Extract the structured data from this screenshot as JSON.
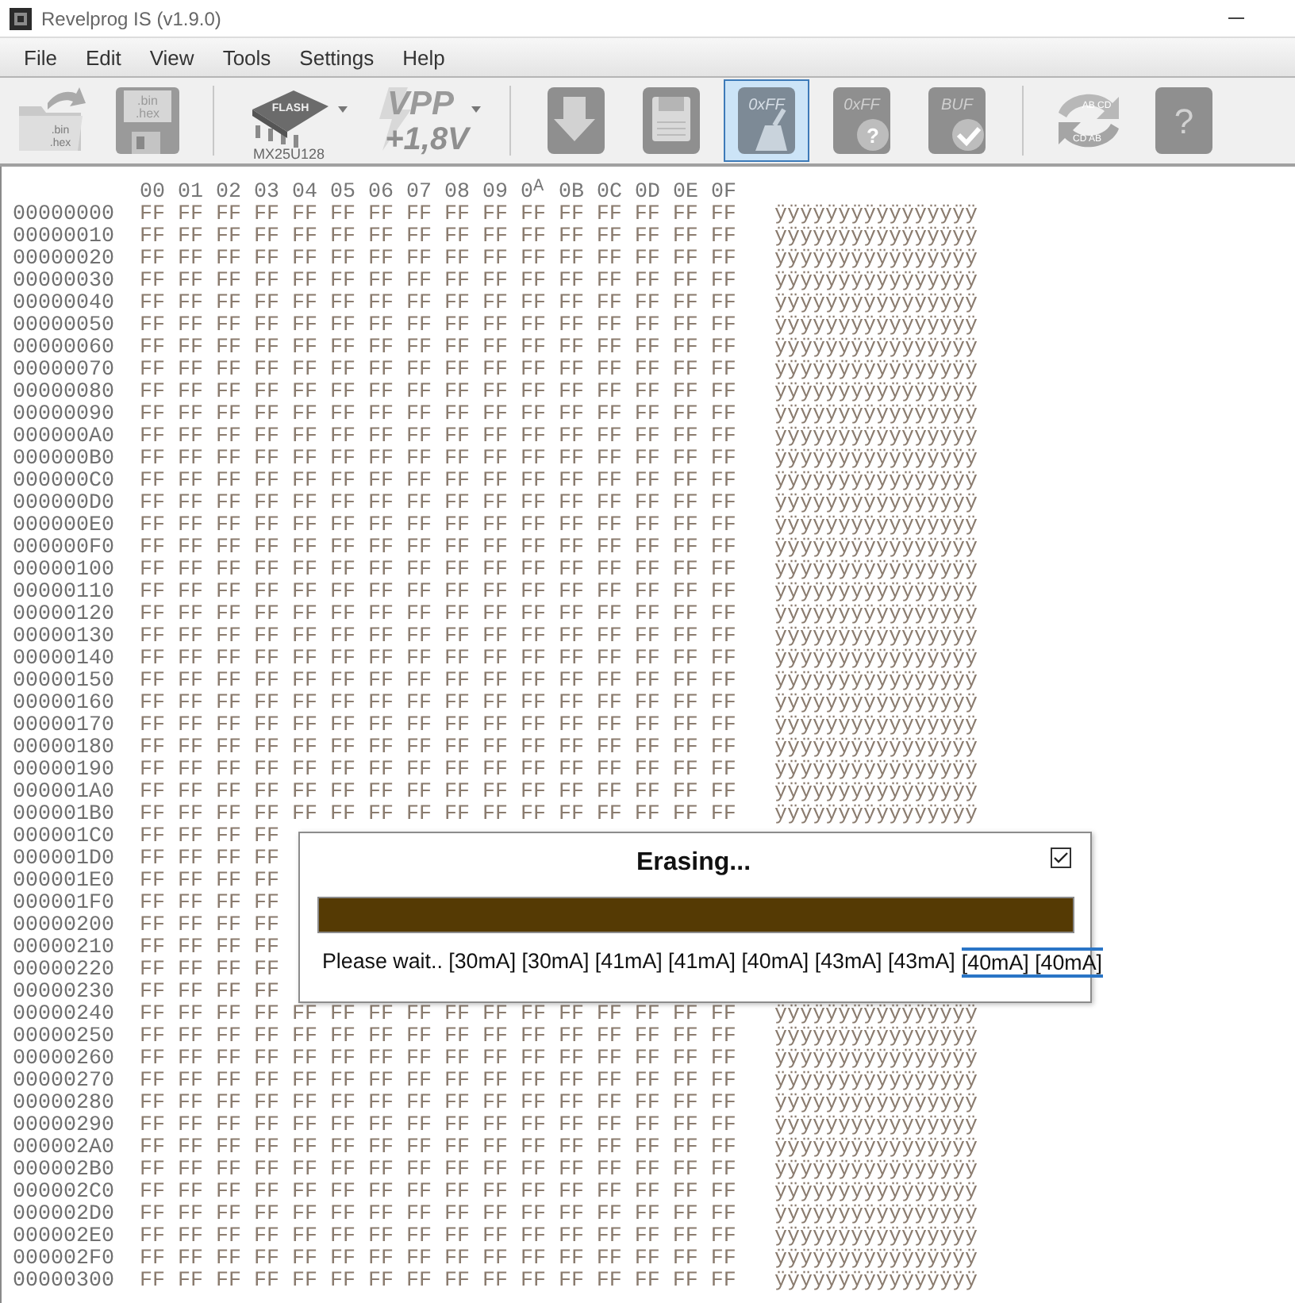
{
  "window": {
    "title": "Revelprog IS (v1.9.0)"
  },
  "menu": [
    "File",
    "Edit",
    "View",
    "Tools",
    "Settings",
    "Help"
  ],
  "toolbar": [
    {
      "kind": "open",
      "texts": [
        ".bin",
        ".hex"
      ],
      "selected": false
    },
    {
      "kind": "save-file",
      "texts": [
        ".bin",
        ".hex"
      ],
      "selected": false
    },
    {
      "kind": "separator"
    },
    {
      "kind": "chip",
      "texts": [
        "FLASH",
        "MX25U128"
      ],
      "dropdown": true,
      "selected": false
    },
    {
      "kind": "vpp",
      "texts": [
        "VPP",
        "+1,8V"
      ],
      "dropdown": true,
      "selected": false
    },
    {
      "kind": "separator"
    },
    {
      "kind": "read",
      "selected": false
    },
    {
      "kind": "save",
      "selected": false
    },
    {
      "kind": "erase",
      "texts": [
        "0xFF"
      ],
      "selected": true
    },
    {
      "kind": "blank-check",
      "texts": [
        "0xFF",
        "?"
      ],
      "selected": false
    },
    {
      "kind": "verify",
      "texts": [
        "BUF"
      ],
      "selected": false
    },
    {
      "kind": "separator"
    },
    {
      "kind": "swap",
      "texts": [
        "AB CD",
        "CD AB"
      ],
      "selected": false
    },
    {
      "kind": "help",
      "texts": [
        "?"
      ],
      "selected": false
    }
  ],
  "hex_view": {
    "columns": [
      "00",
      "01",
      "02",
      "03",
      "04",
      "05",
      "06",
      "07",
      "08",
      "09",
      "0$^{A}$",
      "0B",
      "0C",
      "0D",
      "0E",
      "0F"
    ],
    "rows": [
      {
        "address": "00000000",
        "bytes": "FF FF FF FF FF FF FF FF FF FF FF FF FF FF FF FF",
        "ascii": "ÿÿÿÿÿÿÿÿÿÿÿÿÿÿÿÿ"
      },
      {
        "address": "00000010",
        "bytes": "FF FF FF FF FF FF FF FF FF FF FF FF FF FF FF FF",
        "ascii": "ÿÿÿÿÿÿÿÿÿÿÿÿÿÿÿÿ"
      },
      {
        "address": "00000020",
        "bytes": "FF FF FF FF FF FF FF FF FF FF FF FF FF FF FF FF",
        "ascii": "ÿÿÿÿÿÿÿÿÿÿÿÿÿÿÿÿ"
      },
      {
        "address": "00000030",
        "bytes": "FF FF FF FF FF FF FF FF FF FF FF FF FF FF FF FF",
        "ascii": "ÿÿÿÿÿÿÿÿÿÿÿÿÿÿÿÿ"
      },
      {
        "address": "00000040",
        "bytes": "FF FF FF FF FF FF FF FF FF FF FF FF FF FF FF FF",
        "ascii": "ÿÿÿÿÿÿÿÿÿÿÿÿÿÿÿÿ"
      },
      {
        "address": "00000050",
        "bytes": "FF FF FF FF FF FF FF FF FF FF FF FF FF FF FF FF",
        "ascii": "ÿÿÿÿÿÿÿÿÿÿÿÿÿÿÿÿ"
      },
      {
        "address": "00000060",
        "bytes": "FF FF FF FF FF FF FF FF FF FF FF FF FF FF FF FF",
        "ascii": "ÿÿÿÿÿÿÿÿÿÿÿÿÿÿÿÿ"
      },
      {
        "address": "00000070",
        "bytes": "FF FF FF FF FF FF FF FF FF FF FF FF FF FF FF FF",
        "ascii": "ÿÿÿÿÿÿÿÿÿÿÿÿÿÿÿÿ"
      },
      {
        "address": "00000080",
        "bytes": "FF FF FF FF FF FF FF FF FF FF FF FF FF FF FF FF",
        "ascii": "ÿÿÿÿÿÿÿÿÿÿÿÿÿÿÿÿ"
      },
      {
        "address": "00000090",
        "bytes": "FF FF FF FF FF FF FF FF FF FF FF FF FF FF FF FF",
        "ascii": "ÿÿÿÿÿÿÿÿÿÿÿÿÿÿÿÿ"
      },
      {
        "address": "000000A0",
        "bytes": "FF FF FF FF FF FF FF FF FF FF FF FF FF FF FF FF",
        "ascii": "ÿÿÿÿÿÿÿÿÿÿÿÿÿÿÿÿ"
      },
      {
        "address": "000000B0",
        "bytes": "FF FF FF FF FF FF FF FF FF FF FF FF FF FF FF FF",
        "ascii": "ÿÿÿÿÿÿÿÿÿÿÿÿÿÿÿÿ"
      },
      {
        "address": "000000C0",
        "bytes": "FF FF FF FF FF FF FF FF FF FF FF FF FF FF FF FF",
        "ascii": "ÿÿÿÿÿÿÿÿÿÿÿÿÿÿÿÿ"
      },
      {
        "address": "000000D0",
        "bytes": "FF FF FF FF FF FF FF FF FF FF FF FF FF FF FF FF",
        "ascii": "ÿÿÿÿÿÿÿÿÿÿÿÿÿÿÿÿ"
      },
      {
        "address": "000000E0",
        "bytes": "FF FF FF FF FF FF FF FF FF FF FF FF FF FF FF FF",
        "ascii": "ÿÿÿÿÿÿÿÿÿÿÿÿÿÿÿÿ"
      },
      {
        "address": "000000F0",
        "bytes": "FF FF FF FF FF FF FF FF FF FF FF FF FF FF FF FF",
        "ascii": "ÿÿÿÿÿÿÿÿÿÿÿÿÿÿÿÿ"
      },
      {
        "address": "00000100",
        "bytes": "FF FF FF FF FF FF FF FF FF FF FF FF FF FF FF FF",
        "ascii": "ÿÿÿÿÿÿÿÿÿÿÿÿÿÿÿÿ"
      },
      {
        "address": "00000110",
        "bytes": "FF FF FF FF FF FF FF FF FF FF FF FF FF FF FF FF",
        "ascii": "ÿÿÿÿÿÿÿÿÿÿÿÿÿÿÿÿ"
      },
      {
        "address": "00000120",
        "bytes": "FF FF FF FF FF FF FF FF FF FF FF FF FF FF FF FF",
        "ascii": "ÿÿÿÿÿÿÿÿÿÿÿÿÿÿÿÿ"
      },
      {
        "address": "00000130",
        "bytes": "FF FF FF FF FF FF FF FF FF FF FF FF FF FF FF FF",
        "ascii": "ÿÿÿÿÿÿÿÿÿÿÿÿÿÿÿÿ"
      },
      {
        "address": "00000140",
        "bytes": "FF FF FF FF FF FF FF FF FF FF FF FF FF FF FF FF",
        "ascii": "ÿÿÿÿÿÿÿÿÿÿÿÿÿÿÿÿ"
      },
      {
        "address": "00000150",
        "bytes": "FF FF FF FF FF FF FF FF FF FF FF FF FF FF FF FF",
        "ascii": "ÿÿÿÿÿÿÿÿÿÿÿÿÿÿÿÿ"
      },
      {
        "address": "00000160",
        "bytes": "FF FF FF FF FF FF FF FF FF FF FF FF FF FF FF FF",
        "ascii": "ÿÿÿÿÿÿÿÿÿÿÿÿÿÿÿÿ"
      },
      {
        "address": "00000170",
        "bytes": "FF FF FF FF FF FF FF FF FF FF FF FF FF FF FF FF",
        "ascii": "ÿÿÿÿÿÿÿÿÿÿÿÿÿÿÿÿ"
      },
      {
        "address": "00000180",
        "bytes": "FF FF FF FF FF FF FF FF FF FF FF FF FF FF FF FF",
        "ascii": "ÿÿÿÿÿÿÿÿÿÿÿÿÿÿÿÿ"
      },
      {
        "address": "00000190",
        "bytes": "FF FF FF FF FF FF FF FF FF FF FF FF FF FF FF FF",
        "ascii": "ÿÿÿÿÿÿÿÿÿÿÿÿÿÿÿÿ"
      },
      {
        "address": "000001A0",
        "bytes": "FF FF FF FF FF FF FF FF FF FF FF FF FF FF FF FF",
        "ascii": "ÿÿÿÿÿÿÿÿÿÿÿÿÿÿÿÿ"
      },
      {
        "address": "000001B0",
        "bytes": "FF FF FF FF FF FF FF FF FF FF FF FF FF FF FF FF",
        "ascii": "ÿÿÿÿÿÿÿÿÿÿÿÿÿÿÿÿ"
      },
      {
        "address": "000001C0",
        "bytes": "FF FF FF FF"
      },
      {
        "address": "000001D0",
        "bytes": "FF FF FF FF"
      },
      {
        "address": "000001E0",
        "bytes": "FF FF FF FF"
      },
      {
        "address": "000001F0",
        "bytes": "FF FF FF FF"
      },
      {
        "address": "00000200",
        "bytes": "FF FF FF FF"
      },
      {
        "address": "00000210",
        "bytes": "FF FF FF FF"
      },
      {
        "address": "00000220",
        "bytes": "FF FF FF FF"
      },
      {
        "address": "00000230",
        "bytes": "FF FF FF FF"
      },
      {
        "address": "00000240",
        "bytes": "FF FF FF FF FF FF FF FF FF FF FF FF FF FF FF FF",
        "ascii": "ÿÿÿÿÿÿÿÿÿÿÿÿÿÿÿÿ"
      },
      {
        "address": "00000250",
        "bytes": "FF FF FF FF FF FF FF FF FF FF FF FF FF FF FF FF",
        "ascii": "ÿÿÿÿÿÿÿÿÿÿÿÿÿÿÿÿ"
      },
      {
        "address": "00000260",
        "bytes": "FF FF FF FF FF FF FF FF FF FF FF FF FF FF FF FF",
        "ascii": "ÿÿÿÿÿÿÿÿÿÿÿÿÿÿÿÿ"
      },
      {
        "address": "00000270",
        "bytes": "FF FF FF FF FF FF FF FF FF FF FF FF FF FF FF FF",
        "ascii": "ÿÿÿÿÿÿÿÿÿÿÿÿÿÿÿÿ"
      },
      {
        "address": "00000280",
        "bytes": "FF FF FF FF FF FF FF FF FF FF FF FF FF FF FF FF",
        "ascii": "ÿÿÿÿÿÿÿÿÿÿÿÿÿÿÿÿ"
      },
      {
        "address": "00000290",
        "bytes": "FF FF FF FF FF FF FF FF FF FF FF FF FF FF FF FF",
        "ascii": "ÿÿÿÿÿÿÿÿÿÿÿÿÿÿÿÿ"
      },
      {
        "address": "000002A0",
        "bytes": "FF FF FF FF FF FF FF FF FF FF FF FF FF FF FF FF",
        "ascii": "ÿÿÿÿÿÿÿÿÿÿÿÿÿÿÿÿ"
      },
      {
        "address": "000002B0",
        "bytes": "FF FF FF FF FF FF FF FF FF FF FF FF FF FF FF FF",
        "ascii": "ÿÿÿÿÿÿÿÿÿÿÿÿÿÿÿÿ"
      },
      {
        "address": "000002C0",
        "bytes": "FF FF FF FF FF FF FF FF FF FF FF FF FF FF FF FF",
        "ascii": "ÿÿÿÿÿÿÿÿÿÿÿÿÿÿÿÿ"
      },
      {
        "address": "000002D0",
        "bytes": "FF FF FF FF FF FF FF FF FF FF FF FF FF FF FF FF",
        "ascii": "ÿÿÿÿÿÿÿÿÿÿÿÿÿÿÿÿ"
      },
      {
        "address": "000002E0",
        "bytes": "FF FF FF FF FF FF FF FF FF FF FF FF FF FF FF FF",
        "ascii": "ÿÿÿÿÿÿÿÿÿÿÿÿÿÿÿÿ"
      },
      {
        "address": "000002F0",
        "bytes": "FF FF FF FF FF FF FF FF FF FF FF FF FF FF FF FF",
        "ascii": "ÿÿÿÿÿÿÿÿÿÿÿÿÿÿÿÿ"
      },
      {
        "address": "00000300",
        "bytes": "FF FF FF FF FF FF FF FF FF FF FF FF FF FF FF FF",
        "ascii": "ÿÿÿÿÿÿÿÿÿÿÿÿÿÿÿÿ"
      }
    ]
  },
  "dialog": {
    "title": "Erasing...",
    "checked": true,
    "level": 1,
    "status": "Please wait.. [30mA] [30mA] [41mA] [41mA] [40mA] [43mA] [43mA]",
    "focused": "[40mA] [40mA]"
  }
}
